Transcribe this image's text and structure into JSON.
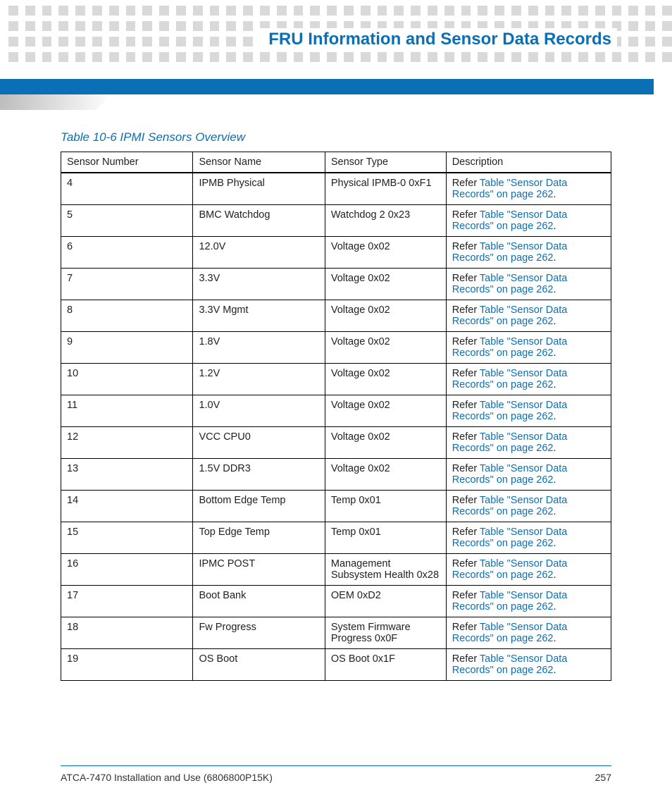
{
  "header": {
    "title": "FRU Information and Sensor Data Records"
  },
  "table": {
    "caption": "Table 10-6 IPMI Sensors Overview",
    "headers": [
      "Sensor Number",
      "Sensor Name",
      "Sensor Type",
      "Description"
    ],
    "desc_prefix": "Refer ",
    "desc_link": "Table \"Sensor Data Records\" on page 262",
    "desc_suffix": ".",
    "rows": [
      {
        "num": "4",
        "name": "IPMB Physical",
        "type": "Physical IPMB-0 0xF1"
      },
      {
        "num": "5",
        "name": "BMC Watchdog",
        "type": "Watchdog 2 0x23"
      },
      {
        "num": "6",
        "name": "12.0V",
        "type": "Voltage 0x02"
      },
      {
        "num": "7",
        "name": "3.3V",
        "type": "Voltage 0x02"
      },
      {
        "num": "8",
        "name": "3.3V Mgmt",
        "type": "Voltage 0x02"
      },
      {
        "num": "9",
        "name": "1.8V",
        "type": "Voltage 0x02"
      },
      {
        "num": "10",
        "name": "1.2V",
        "type": "Voltage 0x02"
      },
      {
        "num": "11",
        "name": "1.0V",
        "type": "Voltage 0x02"
      },
      {
        "num": "12",
        "name": "VCC CPU0",
        "type": "Voltage 0x02"
      },
      {
        "num": "13",
        "name": "1.5V DDR3",
        "type": "Voltage 0x02"
      },
      {
        "num": "14",
        "name": "Bottom Edge Temp",
        "type": "Temp 0x01"
      },
      {
        "num": "15",
        "name": "Top Edge Temp",
        "type": "Temp 0x01"
      },
      {
        "num": "16",
        "name": "IPMC POST",
        "type": "Management Subsystem Health 0x28"
      },
      {
        "num": "17",
        "name": "Boot Bank",
        "type": "OEM  0xD2"
      },
      {
        "num": "18",
        "name": "Fw Progress",
        "type": "System Firmware Progress 0x0F"
      },
      {
        "num": "19",
        "name": "OS Boot",
        "type": "OS Boot 0x1F"
      }
    ]
  },
  "footer": {
    "doc": "ATCA-7470 Installation and Use (6806800P15K)",
    "page": "257"
  }
}
